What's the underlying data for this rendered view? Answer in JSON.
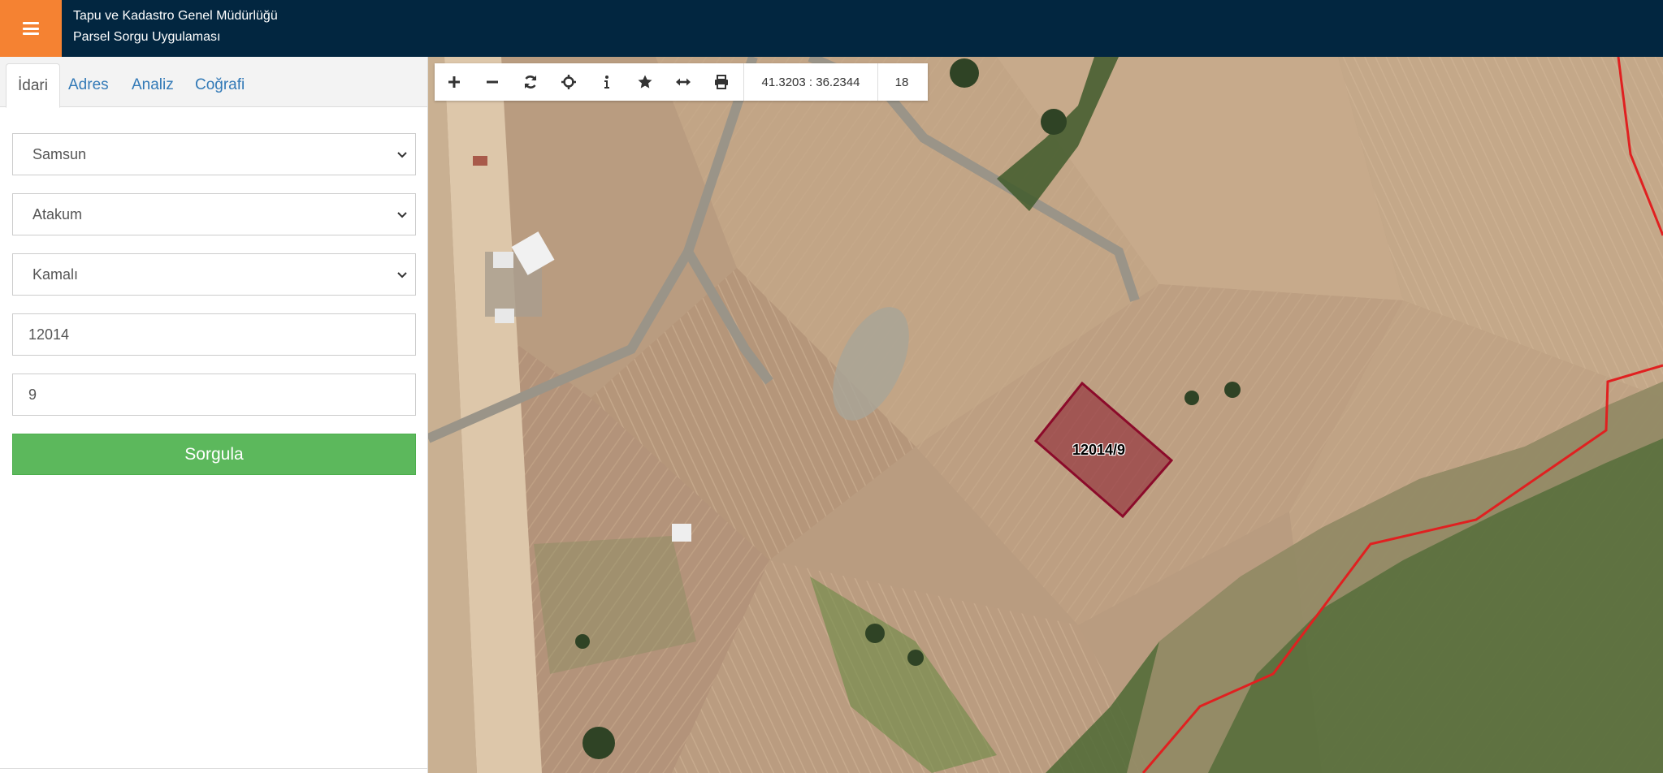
{
  "header": {
    "title_line1": "Tapu ve Kadastro Genel Müdürlüğü",
    "title_line2": "Parsel Sorgu Uygulaması",
    "menu_icon": "hamburger-icon",
    "accent_color": "#f58232",
    "background_color": "#022640"
  },
  "sidebar": {
    "tabs": [
      {
        "label": "İdari"
      },
      {
        "label": "Adres"
      },
      {
        "label": "Analiz"
      },
      {
        "label": "Coğrafi"
      }
    ],
    "province": "Samsun",
    "district": "Atakum",
    "neighborhood": "Kamalı",
    "block": "12014",
    "parcel": "9",
    "submit_label": "Sorgula",
    "submit_color": "#5cb85c"
  },
  "map": {
    "tools": [
      {
        "icon": "plus-icon"
      },
      {
        "icon": "minus-icon"
      },
      {
        "icon": "refresh-icon"
      },
      {
        "icon": "crosshair-icon"
      },
      {
        "icon": "info-icon"
      },
      {
        "icon": "star-icon"
      },
      {
        "icon": "measure-icon"
      },
      {
        "icon": "print-icon"
      }
    ],
    "coordinates": "41.3203 : 36.2344",
    "zoom_level": "18",
    "parcel_label": "12014/9",
    "parcel_color": "#8b0a2a",
    "boundary_color": "#e02020"
  }
}
